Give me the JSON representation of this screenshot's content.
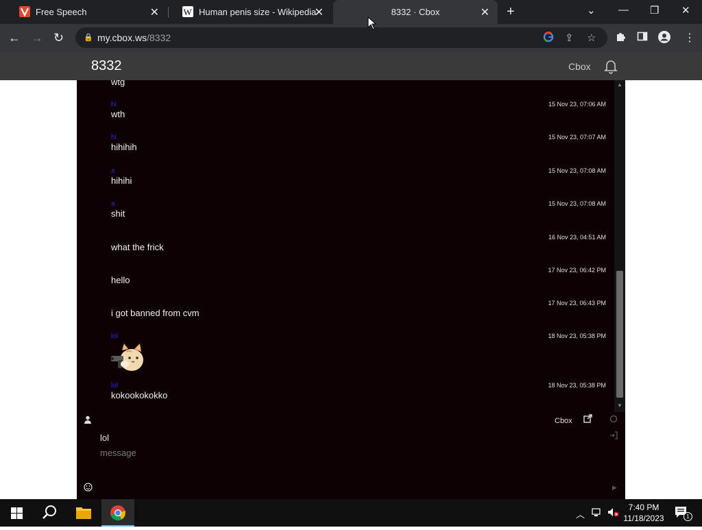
{
  "browser": {
    "tabs": [
      {
        "title": "Free Speech",
        "favicon_icon": "v-logo-icon",
        "favicon_color": "#e8452c"
      },
      {
        "title": "Human penis size - Wikipedia",
        "favicon_icon": "wikipedia-icon",
        "favicon_color": "#ffffff"
      },
      {
        "title": "8332 · Cbox",
        "active": true
      }
    ],
    "address": {
      "domain": "my.cbox.ws",
      "path": "/8332"
    }
  },
  "page": {
    "title": "8332",
    "brand": "Cbox"
  },
  "chat": {
    "messages": [
      {
        "name": "",
        "time": "",
        "body": "wtg"
      },
      {
        "name": "hi",
        "time": "15 Nov 23, 07:06 AM",
        "body": "wth"
      },
      {
        "name": "hi",
        "time": "15 Nov 23, 07:07 AM",
        "body": "hihihih"
      },
      {
        "name": "a",
        "time": "15 Nov 23, 07:08 AM",
        "body": "hihihi"
      },
      {
        "name": "a",
        "time": "15 Nov 23, 07:08 AM",
        "body": "shit"
      },
      {
        "name": "",
        "time": "16 Nov 23, 04:51 AM",
        "body": "what the frick"
      },
      {
        "name": "",
        "time": "17 Nov 23, 06:42 PM",
        "body": "hello"
      },
      {
        "name": "",
        "time": "17 Nov 23, 06:43 PM",
        "body": "i got banned from cvm"
      },
      {
        "name": "lol",
        "time": "18 Nov 23, 05:38 PM",
        "body": ""
      },
      {
        "name": "lol",
        "time": "18 Nov 23, 05:38 PM",
        "body": "kokookokokko"
      }
    ],
    "bar": {
      "link_label": "Cbox"
    },
    "compose": {
      "name_value": "lol",
      "message_placeholder": "message"
    }
  },
  "taskbar": {
    "time": "7:40 PM",
    "date": "11/18/2023",
    "notification_count": "1"
  }
}
